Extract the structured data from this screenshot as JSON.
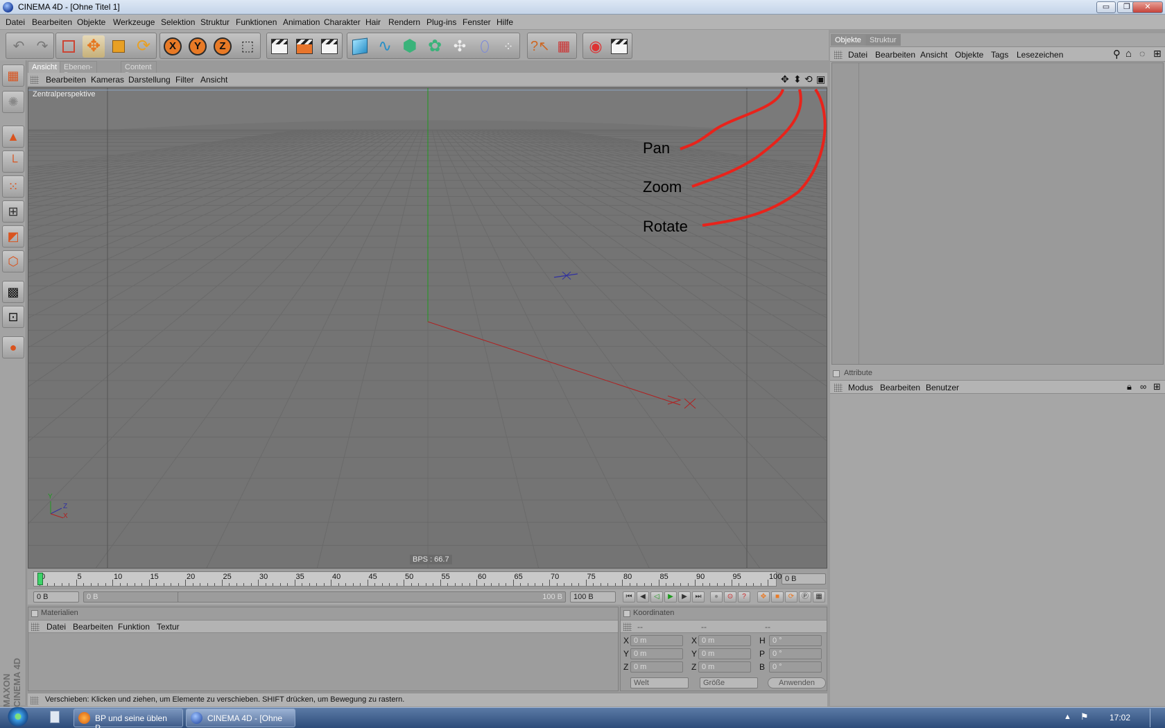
{
  "window": {
    "title": "CINEMA 4D - [Ohne Titel 1]",
    "buttons": [
      "▭",
      "❐",
      "✕"
    ]
  },
  "menu": [
    "Datei",
    "Bearbeiten",
    "Objekte",
    "Werkzeuge",
    "Selektion",
    "Struktur",
    "Funktionen",
    "Animation",
    "Charakter",
    "Hair",
    "Rendern",
    "Plug-ins",
    "Fenster",
    "Hilfe"
  ],
  "viewport_panel": {
    "tabs": [
      "Ansicht",
      "Ebenen-Browser",
      "Content Browser"
    ],
    "menu": [
      "Bearbeiten",
      "Kameras",
      "Darstellung",
      "Filter",
      "Ansicht"
    ],
    "camera_label": "Zentralperspektive",
    "bps": "BPS : 66.7",
    "annotations": [
      "Pan",
      "Zoom",
      "Rotate"
    ],
    "axis_labels": {
      "y": "Y",
      "z": "Z",
      "x": "X"
    }
  },
  "timeline": {
    "ticks": [
      "0",
      "5",
      "10",
      "15",
      "20",
      "25",
      "30",
      "35",
      "40",
      "45",
      "50",
      "55",
      "60",
      "65",
      "70",
      "75",
      "80",
      "85",
      "90",
      "95",
      "100"
    ],
    "current_frame": "0 B",
    "start": "0 B",
    "range_start": "0 B",
    "range_end": "100 B",
    "end": "100 B"
  },
  "materials": {
    "title": "Materialien",
    "menu": [
      "Datei",
      "Bearbeiten",
      "Funktion",
      "Textur"
    ]
  },
  "coordinates": {
    "title": "Koordinaten",
    "headers": [
      "--",
      "--",
      "--"
    ],
    "rows": [
      {
        "a": "X",
        "av": "0 m",
        "b": "X",
        "bv": "0 m",
        "c": "H",
        "cv": "0 °"
      },
      {
        "a": "Y",
        "av": "0 m",
        "b": "Y",
        "bv": "0 m",
        "c": "P",
        "cv": "0 °"
      },
      {
        "a": "Z",
        "av": "0 m",
        "b": "Z",
        "bv": "0 m",
        "c": "B",
        "cv": "0 °"
      }
    ],
    "mode": "Welt",
    "size": "Größe",
    "apply": "Anwenden"
  },
  "status": "Verschieben: Klicken und ziehen, um Elemente zu verschieben. SHIFT drücken, um Bewegung zu rastern.",
  "objects_panel": {
    "tabs": [
      "Objekte",
      "Struktur"
    ],
    "menu": [
      "Datei",
      "Bearbeiten",
      "Ansicht",
      "Objekte",
      "Tags",
      "Lesezeichen"
    ]
  },
  "attributes_panel": {
    "title": "Attribute",
    "menu": [
      "Modus",
      "Bearbeiten",
      "Benutzer"
    ]
  },
  "branding": "MAXON CINEMA 4D",
  "taskbar": {
    "tasks": [
      "BP und seine üblen P...",
      "CINEMA 4D - [Ohne ..."
    ],
    "clock": "17:02"
  },
  "colors": {
    "annotation": "#e8231b",
    "x_axis": "#b02020",
    "y_axis": "#1e9a1e",
    "accent": "#e87a26"
  }
}
